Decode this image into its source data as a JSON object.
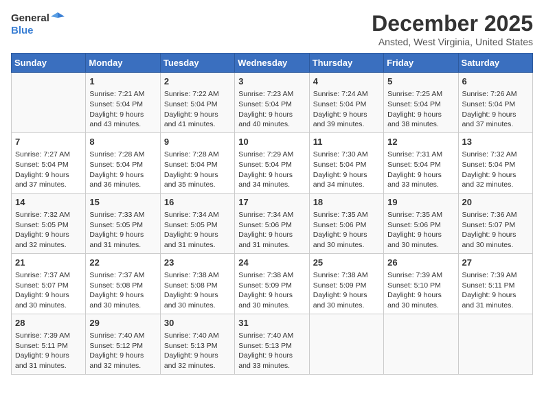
{
  "header": {
    "logo_line1": "General",
    "logo_line2": "Blue",
    "month": "December 2025",
    "location": "Ansted, West Virginia, United States"
  },
  "days_of_week": [
    "Sunday",
    "Monday",
    "Tuesday",
    "Wednesday",
    "Thursday",
    "Friday",
    "Saturday"
  ],
  "weeks": [
    [
      {
        "day": "",
        "info": ""
      },
      {
        "day": "1",
        "info": "Sunrise: 7:21 AM\nSunset: 5:04 PM\nDaylight: 9 hours\nand 43 minutes."
      },
      {
        "day": "2",
        "info": "Sunrise: 7:22 AM\nSunset: 5:04 PM\nDaylight: 9 hours\nand 41 minutes."
      },
      {
        "day": "3",
        "info": "Sunrise: 7:23 AM\nSunset: 5:04 PM\nDaylight: 9 hours\nand 40 minutes."
      },
      {
        "day": "4",
        "info": "Sunrise: 7:24 AM\nSunset: 5:04 PM\nDaylight: 9 hours\nand 39 minutes."
      },
      {
        "day": "5",
        "info": "Sunrise: 7:25 AM\nSunset: 5:04 PM\nDaylight: 9 hours\nand 38 minutes."
      },
      {
        "day": "6",
        "info": "Sunrise: 7:26 AM\nSunset: 5:04 PM\nDaylight: 9 hours\nand 37 minutes."
      }
    ],
    [
      {
        "day": "7",
        "info": "Sunrise: 7:27 AM\nSunset: 5:04 PM\nDaylight: 9 hours\nand 37 minutes."
      },
      {
        "day": "8",
        "info": "Sunrise: 7:28 AM\nSunset: 5:04 PM\nDaylight: 9 hours\nand 36 minutes."
      },
      {
        "day": "9",
        "info": "Sunrise: 7:28 AM\nSunset: 5:04 PM\nDaylight: 9 hours\nand 35 minutes."
      },
      {
        "day": "10",
        "info": "Sunrise: 7:29 AM\nSunset: 5:04 PM\nDaylight: 9 hours\nand 34 minutes."
      },
      {
        "day": "11",
        "info": "Sunrise: 7:30 AM\nSunset: 5:04 PM\nDaylight: 9 hours\nand 34 minutes."
      },
      {
        "day": "12",
        "info": "Sunrise: 7:31 AM\nSunset: 5:04 PM\nDaylight: 9 hours\nand 33 minutes."
      },
      {
        "day": "13",
        "info": "Sunrise: 7:32 AM\nSunset: 5:04 PM\nDaylight: 9 hours\nand 32 minutes."
      }
    ],
    [
      {
        "day": "14",
        "info": "Sunrise: 7:32 AM\nSunset: 5:05 PM\nDaylight: 9 hours\nand 32 minutes."
      },
      {
        "day": "15",
        "info": "Sunrise: 7:33 AM\nSunset: 5:05 PM\nDaylight: 9 hours\nand 31 minutes."
      },
      {
        "day": "16",
        "info": "Sunrise: 7:34 AM\nSunset: 5:05 PM\nDaylight: 9 hours\nand 31 minutes."
      },
      {
        "day": "17",
        "info": "Sunrise: 7:34 AM\nSunset: 5:06 PM\nDaylight: 9 hours\nand 31 minutes."
      },
      {
        "day": "18",
        "info": "Sunrise: 7:35 AM\nSunset: 5:06 PM\nDaylight: 9 hours\nand 30 minutes."
      },
      {
        "day": "19",
        "info": "Sunrise: 7:35 AM\nSunset: 5:06 PM\nDaylight: 9 hours\nand 30 minutes."
      },
      {
        "day": "20",
        "info": "Sunrise: 7:36 AM\nSunset: 5:07 PM\nDaylight: 9 hours\nand 30 minutes."
      }
    ],
    [
      {
        "day": "21",
        "info": "Sunrise: 7:37 AM\nSunset: 5:07 PM\nDaylight: 9 hours\nand 30 minutes."
      },
      {
        "day": "22",
        "info": "Sunrise: 7:37 AM\nSunset: 5:08 PM\nDaylight: 9 hours\nand 30 minutes."
      },
      {
        "day": "23",
        "info": "Sunrise: 7:38 AM\nSunset: 5:08 PM\nDaylight: 9 hours\nand 30 minutes."
      },
      {
        "day": "24",
        "info": "Sunrise: 7:38 AM\nSunset: 5:09 PM\nDaylight: 9 hours\nand 30 minutes."
      },
      {
        "day": "25",
        "info": "Sunrise: 7:38 AM\nSunset: 5:09 PM\nDaylight: 9 hours\nand 30 minutes."
      },
      {
        "day": "26",
        "info": "Sunrise: 7:39 AM\nSunset: 5:10 PM\nDaylight: 9 hours\nand 30 minutes."
      },
      {
        "day": "27",
        "info": "Sunrise: 7:39 AM\nSunset: 5:11 PM\nDaylight: 9 hours\nand 31 minutes."
      }
    ],
    [
      {
        "day": "28",
        "info": "Sunrise: 7:39 AM\nSunset: 5:11 PM\nDaylight: 9 hours\nand 31 minutes."
      },
      {
        "day": "29",
        "info": "Sunrise: 7:40 AM\nSunset: 5:12 PM\nDaylight: 9 hours\nand 32 minutes."
      },
      {
        "day": "30",
        "info": "Sunrise: 7:40 AM\nSunset: 5:13 PM\nDaylight: 9 hours\nand 32 minutes."
      },
      {
        "day": "31",
        "info": "Sunrise: 7:40 AM\nSunset: 5:13 PM\nDaylight: 9 hours\nand 33 minutes."
      },
      {
        "day": "",
        "info": ""
      },
      {
        "day": "",
        "info": ""
      },
      {
        "day": "",
        "info": ""
      }
    ]
  ]
}
